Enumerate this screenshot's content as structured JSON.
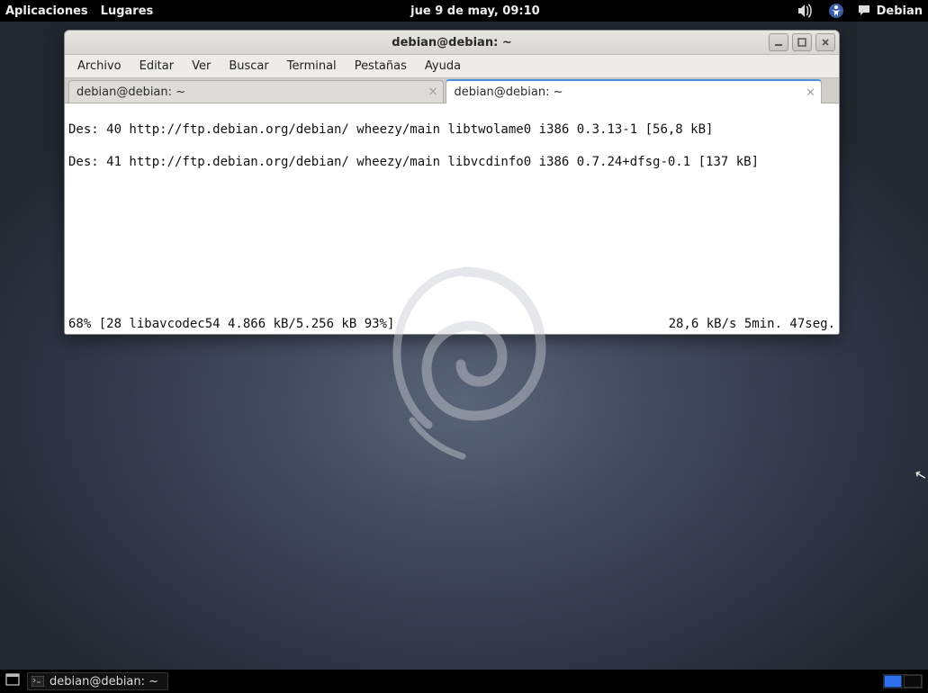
{
  "top_panel": {
    "apps": "Aplicaciones",
    "places": "Lugares",
    "clock": "jue  9 de may, 09:10",
    "os_label": "Debian"
  },
  "window": {
    "title": "debian@debian: ~",
    "menu": {
      "file": "Archivo",
      "edit": "Editar",
      "view": "Ver",
      "search": "Buscar",
      "terminal": "Terminal",
      "tabs": "Pestañas",
      "help": "Ayuda"
    },
    "tabs": {
      "t1": "debian@debian: ~",
      "t2": "debian@debian: ~"
    },
    "output": {
      "l1": "Des: 40 http://ftp.debian.org/debian/ wheezy/main libtwolame0 i386 0.3.13-1 [56,8 kB]",
      "l2": "Des: 41 http://ftp.debian.org/debian/ wheezy/main libvcdinfo0 i386 0.7.24+dfsg-0.1 [137 kB]",
      "status_left": "68% [28 libavcodec54 4.866 kB/5.256 kB 93%]",
      "status_right": "28,6 kB/s 5min. 47seg."
    }
  },
  "taskbar": {
    "item1": "debian@debian: ~"
  }
}
